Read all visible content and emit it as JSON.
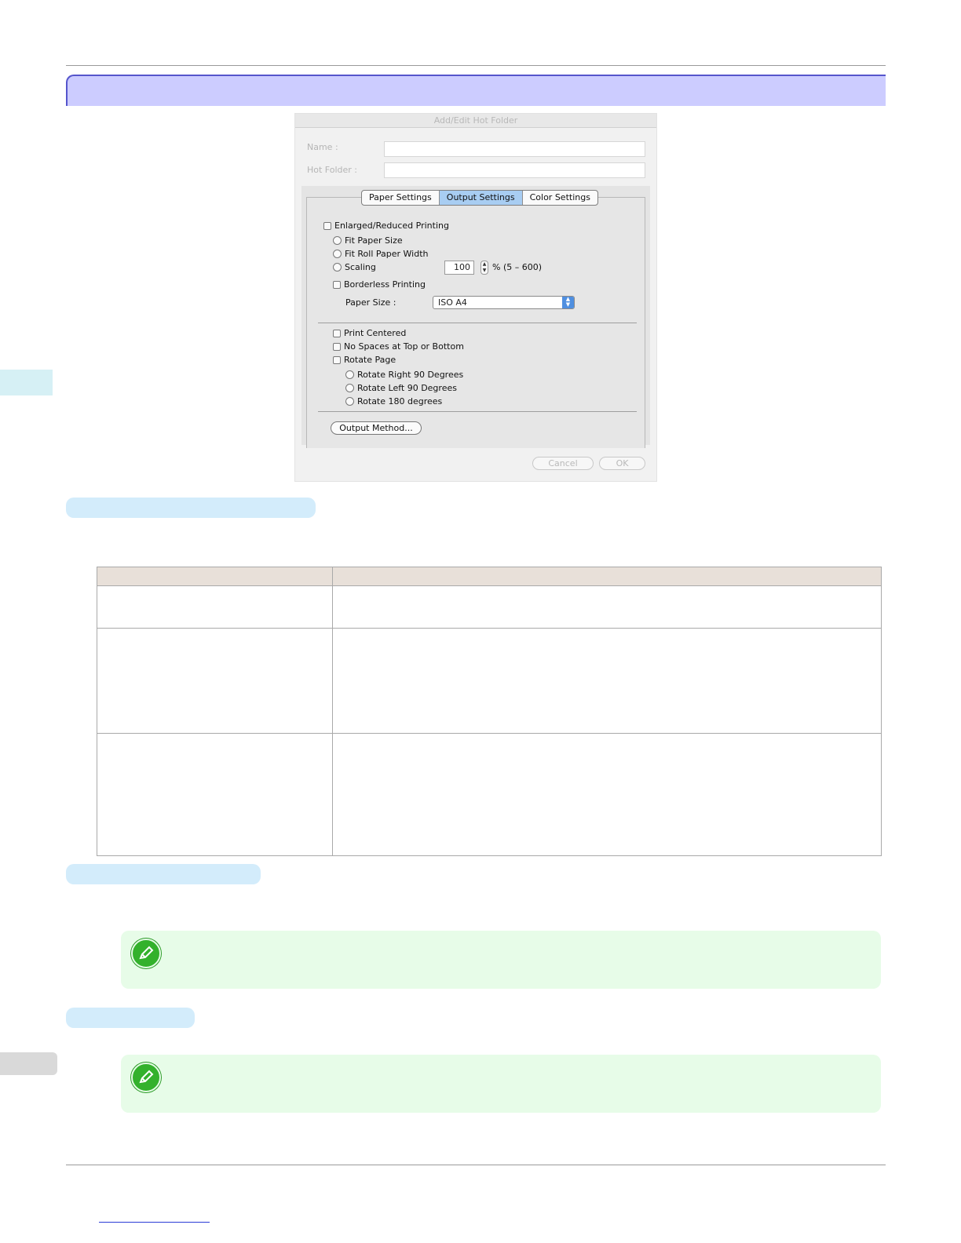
{
  "dialog": {
    "title": "Add/Edit Hot Folder",
    "name_label": "Name :",
    "hot_folder_label": "Hot Folder :",
    "tabs": [
      "Paper Settings",
      "Output Settings",
      "Color Settings"
    ],
    "active_tab": "Output Settings",
    "enlarged_reduced": "Enlarged/Reduced Printing",
    "fit_paper_size": "Fit Paper Size",
    "fit_roll_paper_width": "Fit Roll Paper Width",
    "scaling": "Scaling",
    "scaling_value": "100",
    "scaling_range": "% (5 – 600)",
    "borderless": "Borderless Printing",
    "paper_size_label": "Paper Size :",
    "paper_size_value": "ISO A4",
    "print_centered": "Print Centered",
    "no_spaces": "No Spaces at Top or Bottom",
    "rotate_page": "Rotate Page",
    "rotate_right": "Rotate Right 90 Degrees",
    "rotate_left": "Rotate Left 90 Degrees",
    "rotate_180": "Rotate 180 degrees",
    "output_method_button": "Output Method...",
    "cancel_button": "Cancel",
    "ok_button": "OK"
  }
}
